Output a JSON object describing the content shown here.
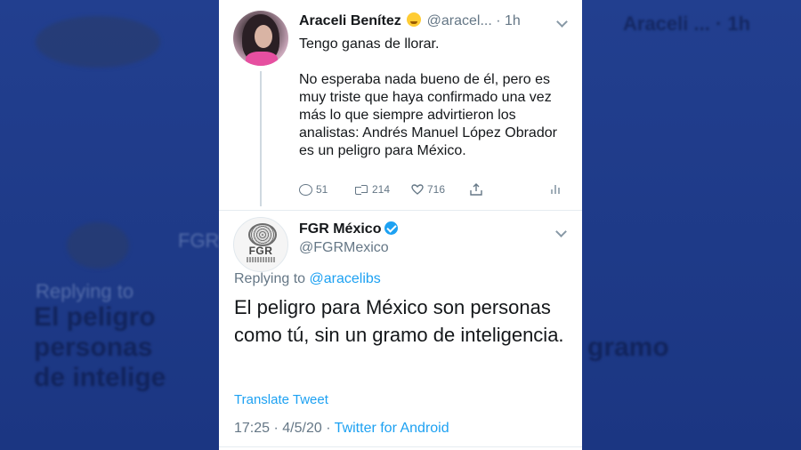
{
  "tweet_original": {
    "display_name": "Araceli Benítez",
    "handle": "@aracel...",
    "time": "· 1h",
    "text": "Tengo ganas de llorar.\n\nNo esperaba nada bueno de él, pero es muy triste que haya confirmado una vez más lo que siempre advirtieron los analistas: Andrés Manuel López Obrador es un peligro para México.",
    "emoji_icon": "grimacing-face-emoji",
    "stats": {
      "replies": "51",
      "retweets": "214",
      "likes": "716"
    }
  },
  "tweet_reply": {
    "display_name": "FGR México",
    "handle": "@FGRMexico",
    "avatar_label": "FGR",
    "replying_prefix": "Replying to",
    "replying_to": "@aracelibs",
    "text": "El peligro para México son personas como tú, sin un gramo de inteligencia.",
    "translate_label": "Translate Tweet",
    "timestamp": "17:25 · 4/5/20 ·",
    "source": "Twitter for Android"
  },
  "background_ghost": {
    "name": "Araceli ... · 1h",
    "fgr": "FGR",
    "replying": "Replying to",
    "line1": "El peligro",
    "line2": "personas",
    "line3": "de intelige"
  },
  "colors": {
    "background": "#1d3a8a",
    "link": "#1da1f2",
    "text": "#14171a",
    "secondary": "#657786"
  }
}
